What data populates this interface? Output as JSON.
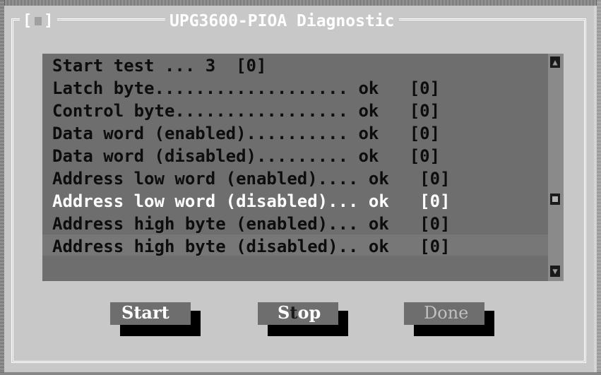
{
  "window": {
    "close_box_open": "[",
    "close_box_close": "]",
    "title": "UPG3600-PIOA Diagnostic"
  },
  "list": {
    "rows": [
      "Start test ... 3  [0]",
      "Latch byte................... ok   [0]",
      "Control byte................. ok   [0]",
      "Data word (enabled).......... ok   [0]",
      "Data word (disabled)......... ok   [0]",
      "Address low word (enabled).... ok   [0]",
      "Address low word (disabled)... ok   [0]",
      "Address high byte (enabled)... ok   [0]",
      "Address high byte (disabled).. ok   [0]"
    ],
    "selected_index": 6
  },
  "scrollbar": {
    "up_icon": "arrow-up-icon",
    "down_icon": "arrow-down-icon",
    "up_glyph": "▲",
    "down_glyph": "▼"
  },
  "buttons": {
    "start": {
      "pre": "",
      "hot": "",
      "post": "Start"
    },
    "stop": {
      "pre": "S",
      "hot": "t",
      "post": "op"
    },
    "done": {
      "label": "Done",
      "enabled": false
    }
  },
  "colors": {
    "dialog_bg": "#c8c8c8",
    "list_bg": "#6e6e6e",
    "button_face": "#6e6e6e",
    "text_selected": "#ffffff",
    "text_normal": "#0d0d0d"
  }
}
